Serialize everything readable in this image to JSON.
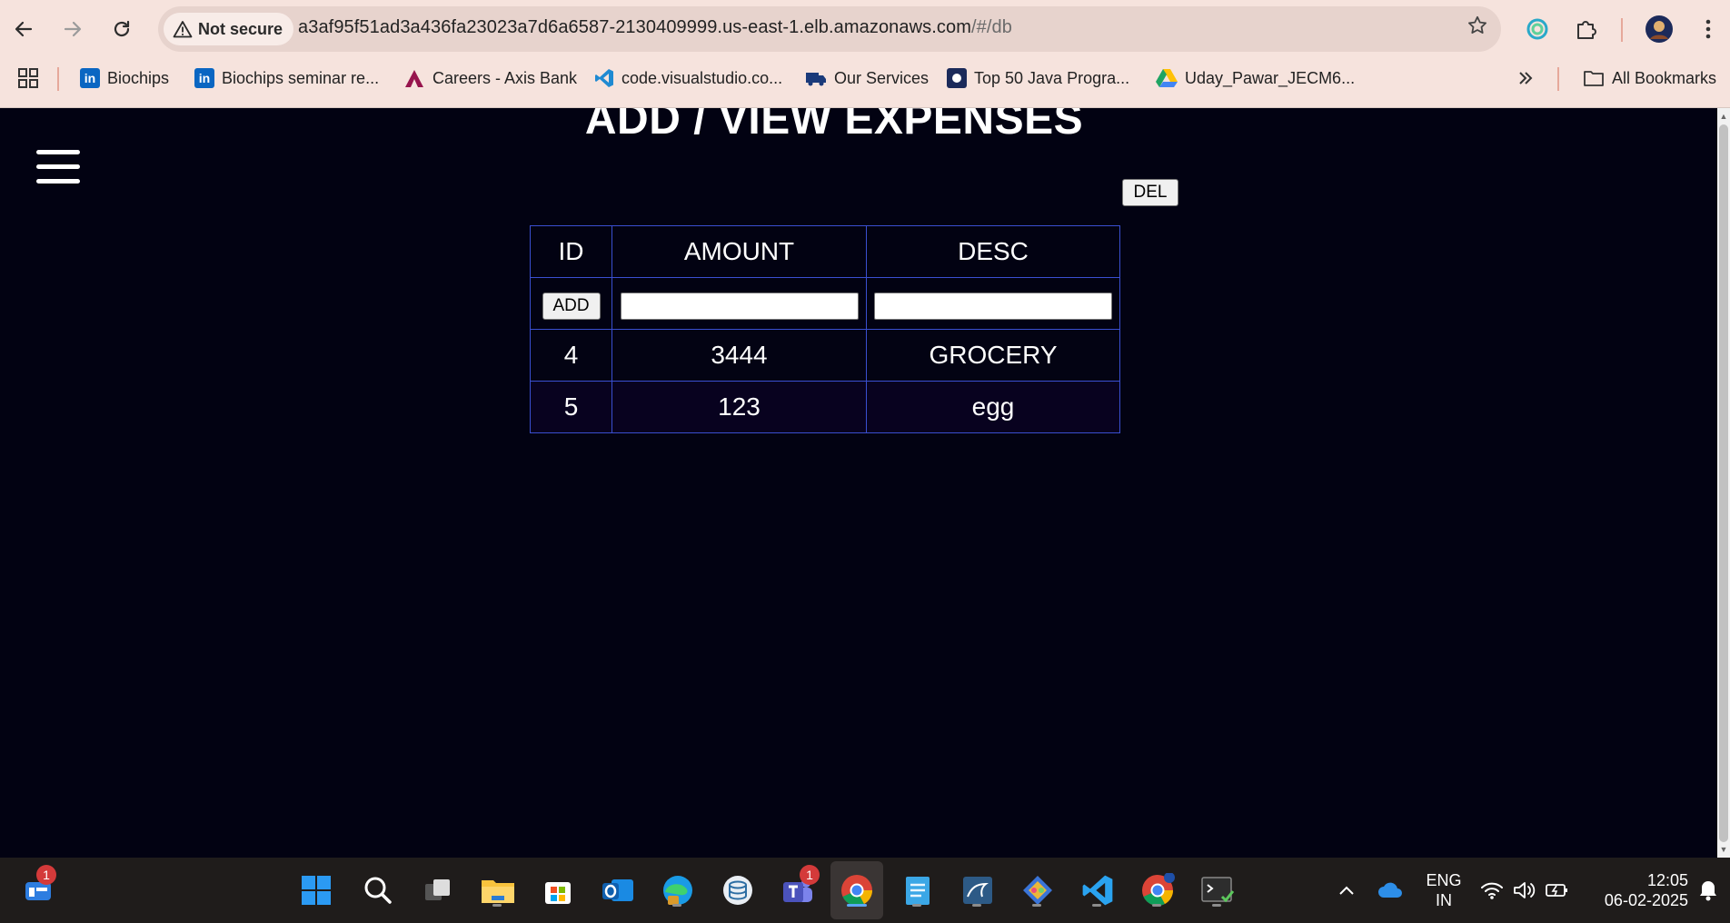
{
  "browser": {
    "security_label": "Not secure",
    "url_host": "a3af95f51ad3a436fa23023a7d6a6587-2130409999.us-east-1.elb.amazonaws.com",
    "url_path": "/#/db",
    "bookmarks": [
      {
        "label": "Biochips",
        "icon": "linkedin-icon",
        "color": "#0a66c2"
      },
      {
        "label": "Biochips seminar re...",
        "icon": "linkedin-icon",
        "color": "#0a66c2"
      },
      {
        "label": "Careers - Axis Bank",
        "icon": "axis-bank-icon",
        "color": "#97144d"
      },
      {
        "label": "code.visualstudio.co...",
        "icon": "vscode-icon",
        "color": "#007acc"
      },
      {
        "label": "Our Services",
        "icon": "truck-icon",
        "color": "#1a3a7a"
      },
      {
        "label": "Top 50 Java Progra...",
        "icon": "java-site-icon",
        "color": "#1b2a5a"
      },
      {
        "label": "Uday_Pawar_JECM6...",
        "icon": "google-drive-icon",
        "color": "#1fa463"
      }
    ],
    "all_bookmarks_label": "All Bookmarks"
  },
  "page": {
    "title": "ADD / VIEW EXPENSES",
    "del_label": "DEL",
    "add_label": "ADD",
    "columns": [
      "ID",
      "AMOUNT",
      "DESC"
    ],
    "amount_input_value": "",
    "desc_input_value": "",
    "rows": [
      {
        "id": "4",
        "amount": "3444",
        "desc": "GROCERY"
      },
      {
        "id": "5",
        "amount": "123",
        "desc": "egg"
      }
    ]
  },
  "taskbar": {
    "widgets_badge": "1",
    "teams_badge": "1",
    "language": "ENG",
    "region": "IN",
    "time": "12:05",
    "date": "06-02-2025"
  }
}
